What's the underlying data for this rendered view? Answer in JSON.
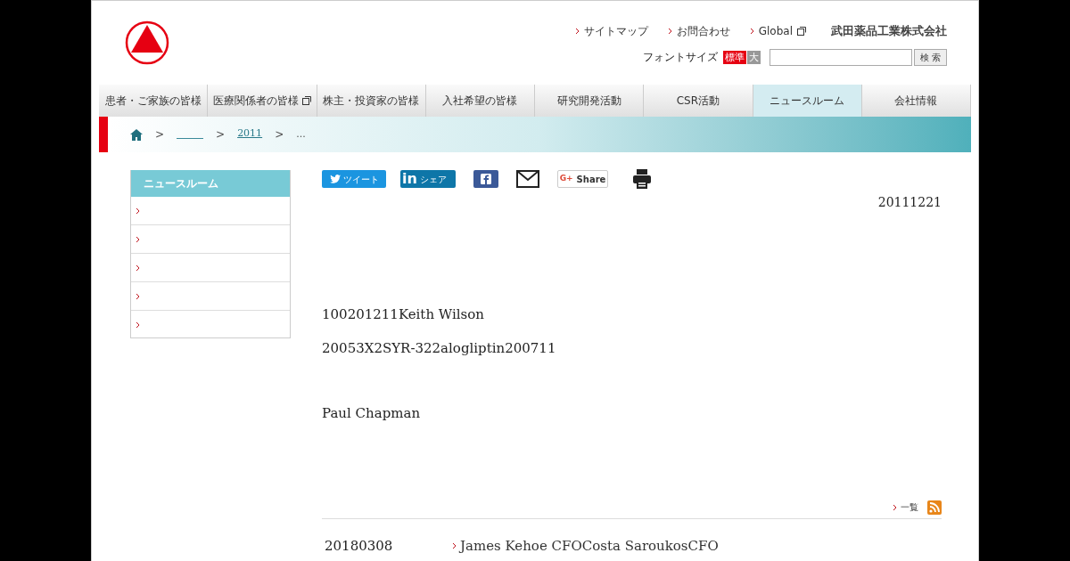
{
  "header": {
    "links": [
      {
        "label": "サイトマップ",
        "external": false
      },
      {
        "label": "お問合わせ",
        "external": false
      },
      {
        "label": "Global",
        "external": true
      }
    ],
    "company": "武田薬品工業株式会社",
    "font_size": {
      "label": "フォントサイズ",
      "options": [
        {
          "label": "標準",
          "selected": true
        },
        {
          "label": "大",
          "selected": false
        }
      ]
    },
    "search": {
      "button": "検 索"
    }
  },
  "nav": [
    {
      "label": "患者・ご家族の皆様",
      "selected": false,
      "external": false
    },
    {
      "label": "医療関係者の皆様",
      "selected": false,
      "external": true
    },
    {
      "label": "株主・投資家の皆様",
      "selected": false,
      "external": false
    },
    {
      "label": "入社希望の皆様",
      "selected": false,
      "external": false
    },
    {
      "label": "研究開発活動",
      "selected": false,
      "external": false
    },
    {
      "label": "CSR活動",
      "selected": false,
      "external": false
    },
    {
      "label": "ニュースルーム",
      "selected": true,
      "external": false
    },
    {
      "label": "会社情報",
      "selected": false,
      "external": false
    }
  ],
  "breadcrumb": {
    "separators": [
      ">",
      ">",
      ">"
    ],
    "links": [
      "2011"
    ],
    "current": "..."
  },
  "sidebar": {
    "title": "ニュースルーム"
  },
  "share": {
    "tweet": "ツイート",
    "linkedin_logo": "in",
    "linkedin": "シェア",
    "google_logo": "G+",
    "google": "Share"
  },
  "article": {
    "date": "20111221",
    "paragraphs": [
      "100201211Keith Wilson",
      "20053X2SYR-322alogliptin200711",
      "Paul Chapman"
    ]
  },
  "news": {
    "list_link": "一覧",
    "items": [
      {
        "date": "20180308",
        "title": "James Kehoe CFOCosta SaroukosCFO"
      }
    ]
  }
}
